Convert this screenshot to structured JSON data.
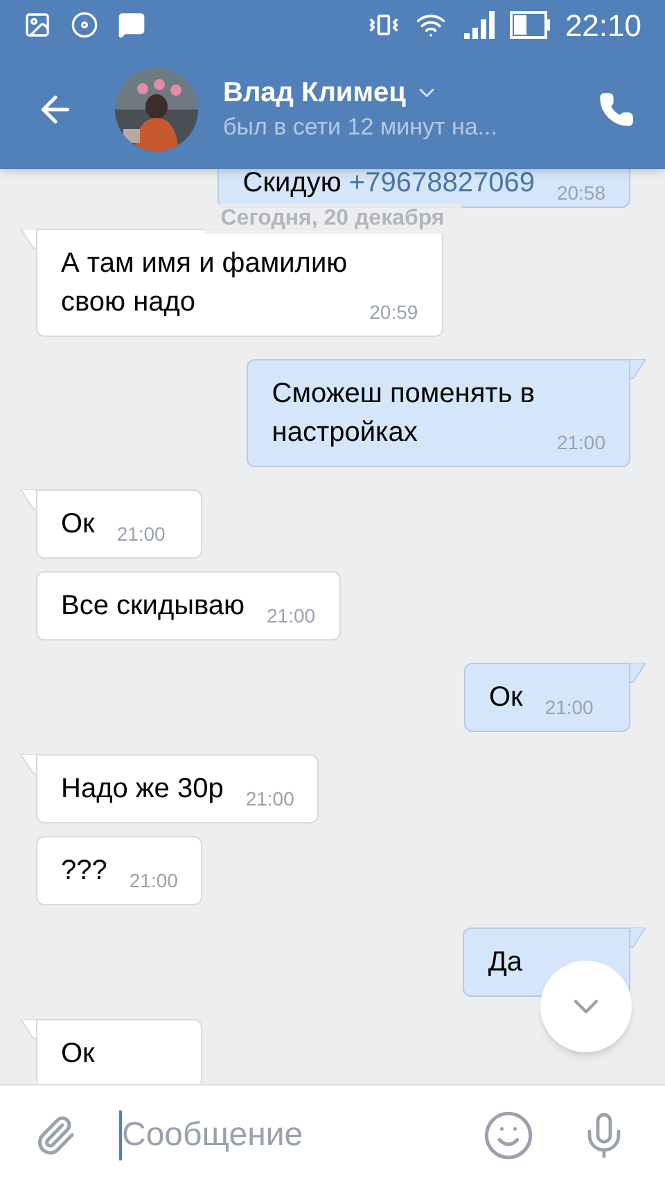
{
  "status_bar": {
    "time": "22:10"
  },
  "header": {
    "name": "Влад Климец",
    "status": "был в сети 12 минут на..."
  },
  "date_pill": "Сегодня, 20 декабря",
  "messages": [
    {
      "kind": "out",
      "text": "Скидую",
      "link": "+79678827069",
      "time": "20:58",
      "tail": false
    },
    {
      "kind": "in",
      "text": "А там имя и фамилию\nсвою надо",
      "time": "20:59",
      "tail": true
    },
    {
      "kind": "out",
      "text": "Сможеш поменять в\nнастройках",
      "time": "21:00",
      "tail": true
    },
    {
      "kind": "in",
      "text": "Ок",
      "time": "21:00",
      "tail": true
    },
    {
      "kind": "in",
      "text": "Все скидываю",
      "time": "21:00",
      "tail": false
    },
    {
      "kind": "out",
      "text": "Ок",
      "time": "21:00",
      "tail": true
    },
    {
      "kind": "in",
      "text": "Надо же 30р",
      "time": "21:00",
      "tail": true
    },
    {
      "kind": "in",
      "text": "???",
      "time": "21:00",
      "tail": false
    },
    {
      "kind": "out",
      "text": "Да",
      "tail": true
    },
    {
      "kind": "in",
      "text": "Ок",
      "tail": true
    }
  ],
  "composer": {
    "placeholder": "Сообщение"
  }
}
